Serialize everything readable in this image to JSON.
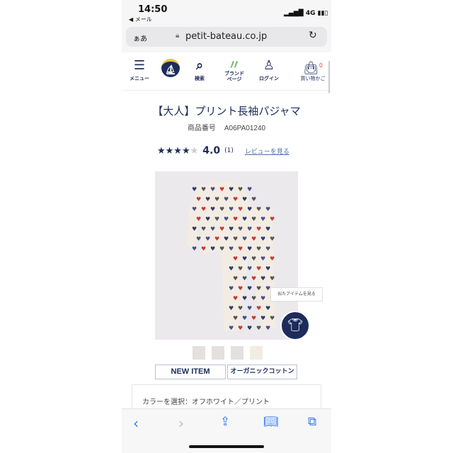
{
  "status": {
    "time": "14:50",
    "back_app": "◀ メール",
    "network": "4G"
  },
  "browser": {
    "text_size": "ぁあ",
    "url": "petit-bateau.co.jp"
  },
  "nav": {
    "menu": "メニュー",
    "search": "検索",
    "brand": "ブランド\nページ",
    "login": "ログイン",
    "cart": "買い物かご",
    "cart_count": "0"
  },
  "product": {
    "title": "【大人】プリント長袖パジャマ",
    "code_label": "商品番号",
    "code": "A06PA01240",
    "rating": 4.0,
    "rating_text": "4.0",
    "review_count": "(1)",
    "review_link": "レビューを見る",
    "similar_tip": "似たアイテムを見る",
    "tags": [
      "NEW ITEM",
      "オーガニックコットン"
    ],
    "color_label": "カラーを選択：オフホワイト／プリント"
  },
  "colors": {
    "navy": "#1d2c5b",
    "accent": "#3478f6",
    "cart_badge": "#e8452c"
  }
}
